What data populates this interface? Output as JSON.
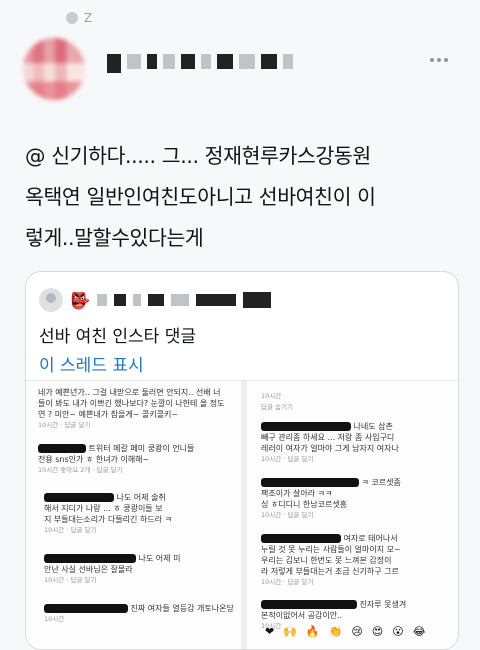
{
  "top_mark": "Z",
  "tweet": {
    "text": "@ 신기하다..... 그... 정재현루카스강동원\n옥택연 일반인여친도아니고 선바여친이 이\n렇게..말할수있다는게"
  },
  "quote": {
    "title": "선바 여친 인스타 댓글",
    "show_thread": "이 스레드 표시"
  },
  "left_comments": [
    {
      "text": "네가 예쁜년가.. 그걸 내맏으로 둘러면 안되지.. 선배 너",
      "text2": "들이 봐도 내가 이쁘긴 했나보다? 눈깔이 나한테 올 정도",
      "text3": "연 ? 미안~ 예쁜내가 참을게~ 콜키콜키~",
      "meta": "10시간",
      "reply": "답글 달기"
    },
    {
      "text": "트위터 메갈 페미 쿵쾅이 언니들",
      "text2": "전용 sns인가 ㅎ 한녀가 이해해~",
      "meta": "10시간  좋아요 2개",
      "reply": "답글 달기"
    },
    {
      "text": "나도 어제 술취",
      "text2": "해서 지디가 나랑 ... ㅎ 쿵쾅이들 보",
      "text3": "지 부들대는소리가 다들리긴 하드라 ㅋ",
      "meta": "10시간",
      "reply": "답글 달기"
    },
    {
      "text": "나도 어제 미",
      "text2": "안난 사실 선바님은 잘몰라",
      "meta": "10시간",
      "reply": "답글 달기"
    },
    {
      "text": "진짜 여자들 열등감 개토나온당",
      "meta": "10시간"
    }
  ],
  "right_comments": [
    {
      "text": "답글 숨기기",
      "meta": "10시간"
    },
    {
      "text": "나네도 삼촌",
      "text2": "빼구 관리좀 하세요 ... 저랑 좀 사입구디",
      "text3": "레러이 여자가 얼마야 그게 남자지 여자나",
      "meta": "10시간",
      "reply": "답글 달기"
    },
    {
      "text": "ㅋ 코르셋좀",
      "text2": "팩조이가 살아라 ㅋㅋ",
      "text3": "싱 ㅎ디디니 한남코르셋흥",
      "meta": "10시간",
      "reply": "답글 달기"
    },
    {
      "text": "여자로 태어나서",
      "text2": "누릴 것 못 누리는 사람들이 얼마이지 모~",
      "text3": "우리는 김보니 한번도 못 느껴본 감정이",
      "text4": "라 저렇게 부들대는거 조금 신기하구 그르",
      "meta": "10시간",
      "reply": "답글 달기"
    },
    {
      "text": "진자루 못생겨",
      "text2": "본적이없어서 공감이안..",
      "meta": "10시간"
    }
  ],
  "emojis": [
    "❤",
    "🙌",
    "🔥",
    "👏",
    "😢",
    "😍",
    "😮",
    "😂"
  ]
}
